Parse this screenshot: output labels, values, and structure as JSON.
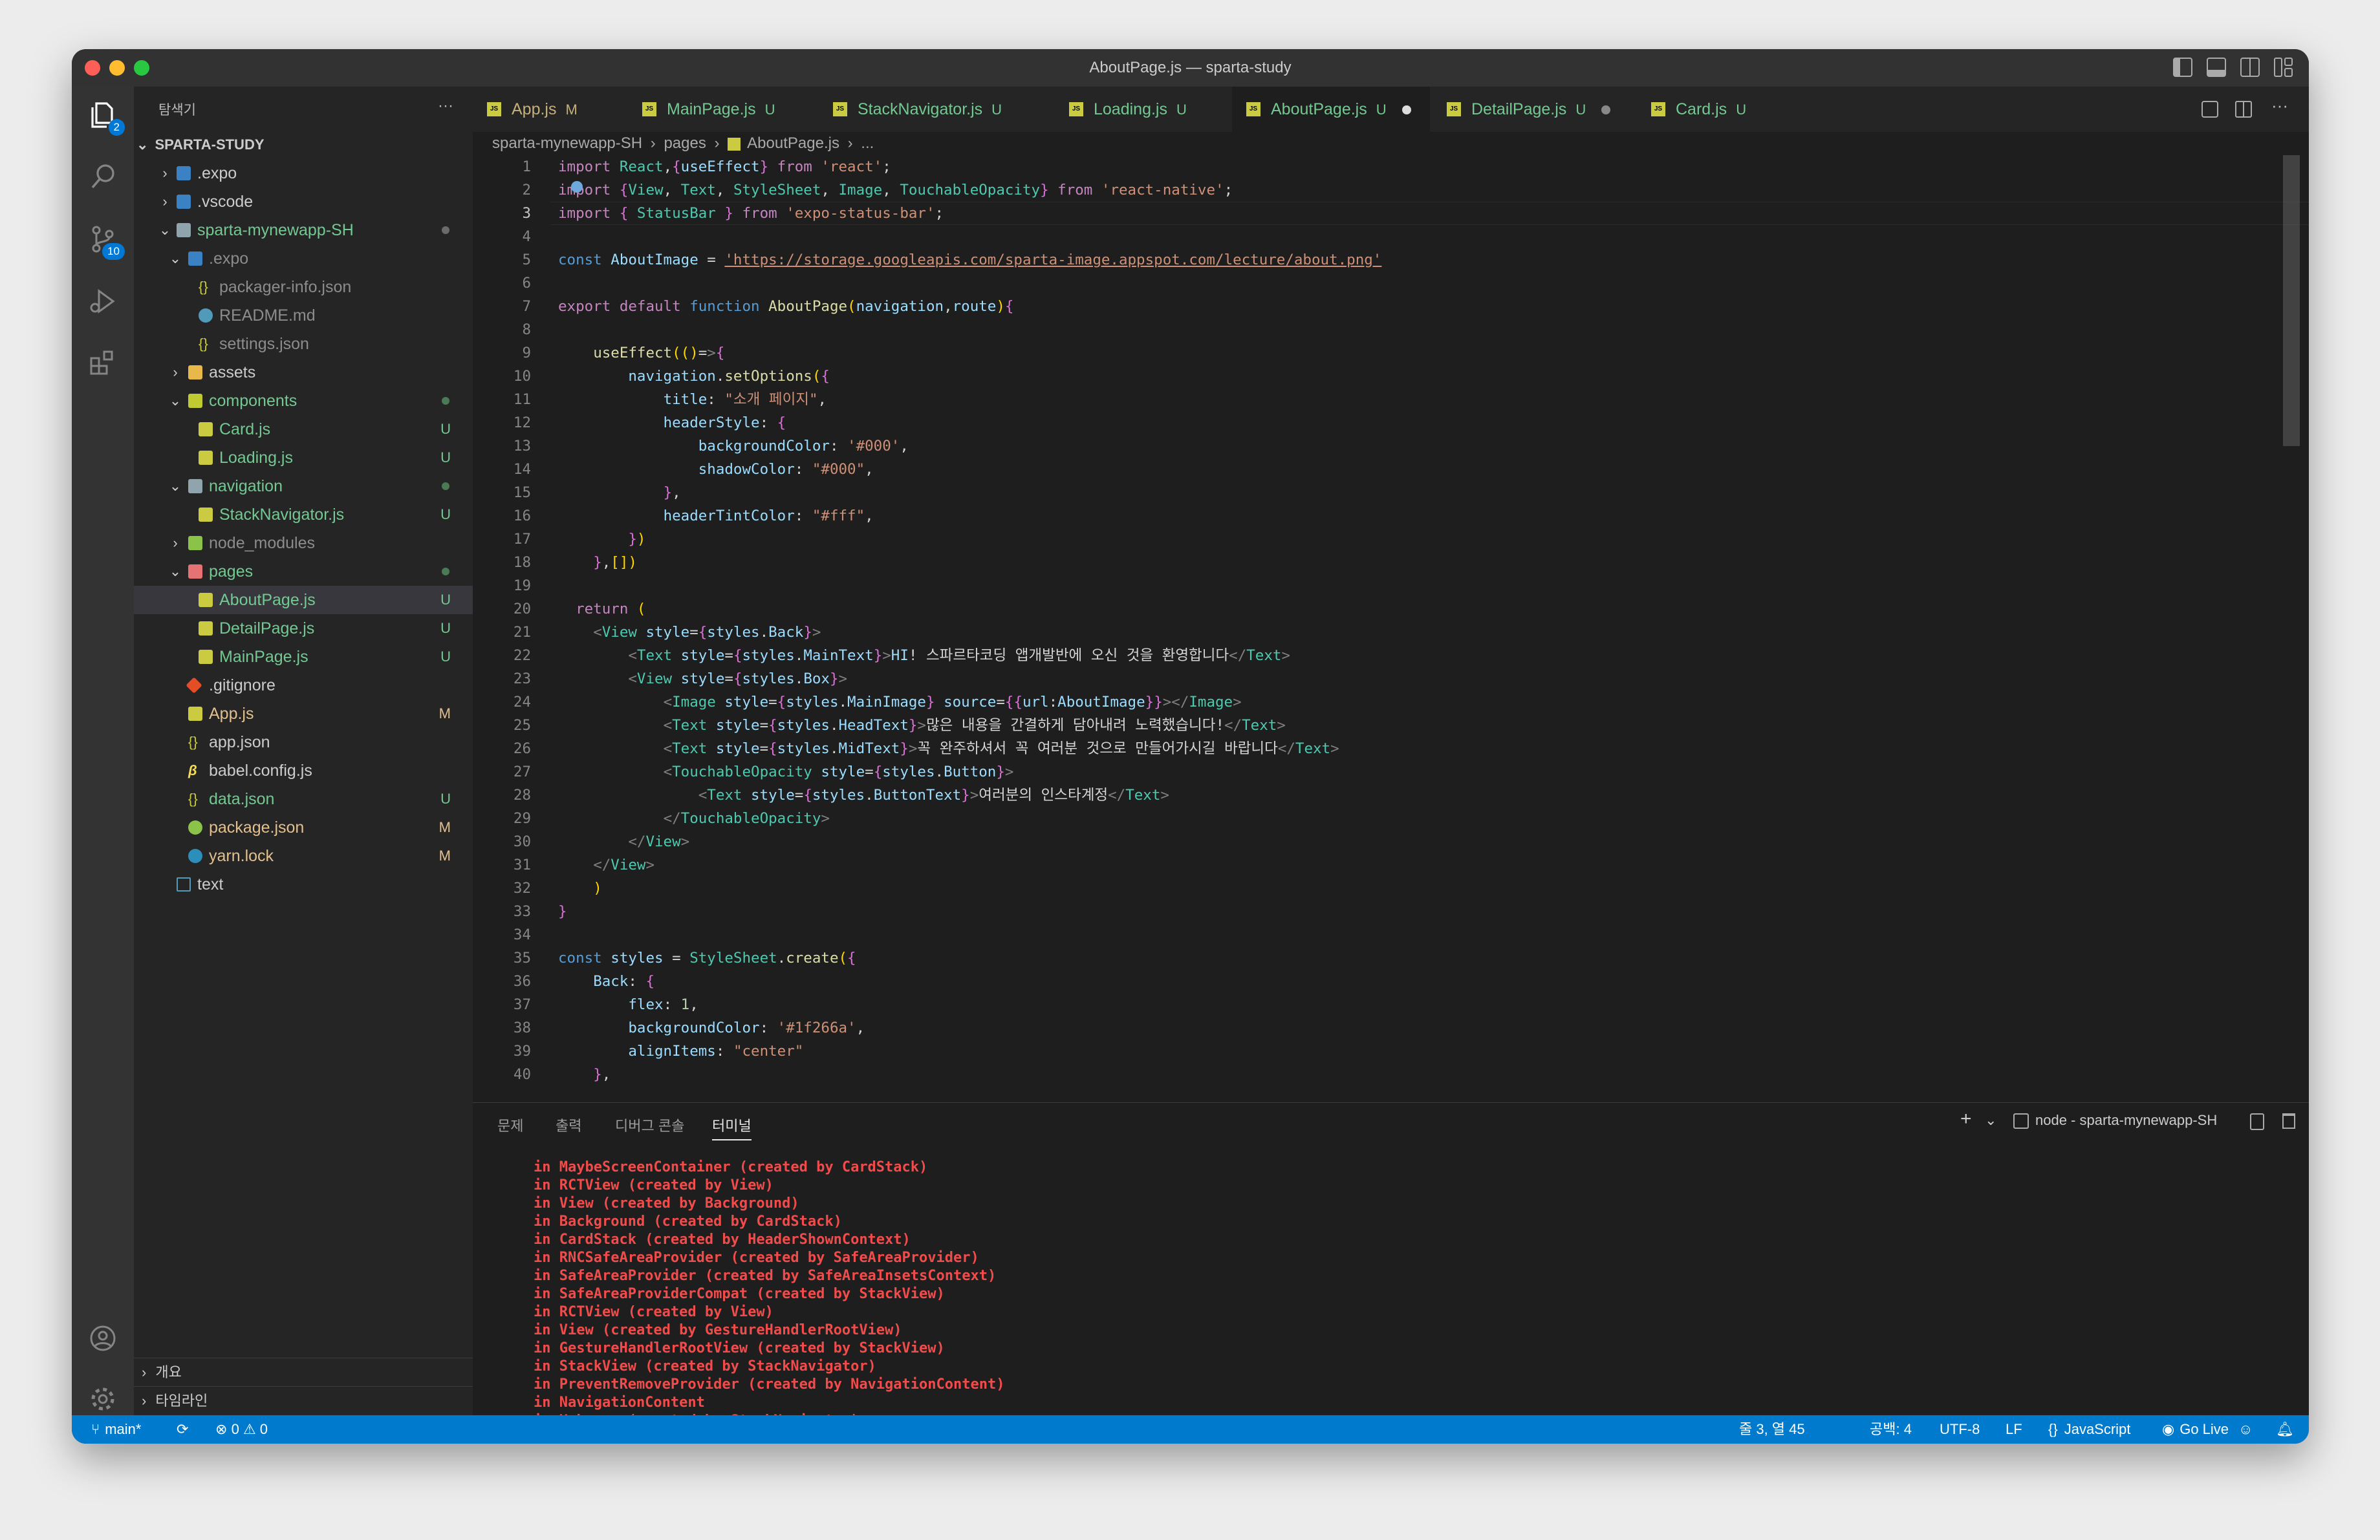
{
  "window": {
    "title": "AboutPage.js — sparta-study"
  },
  "activity_bar": {
    "explorer_badge": "2",
    "scm_badge": "10"
  },
  "sidebar": {
    "header": "탐색기",
    "more": "···",
    "project": "SPARTA-STUDY",
    "tree": [
      {
        "label": "expo",
        "prefix": ".",
        "status": "",
        "indent": 0
      },
      {
        "label": ".expo",
        "status": "",
        "kind": "folder"
      },
      {
        "label": ".vscode",
        "status": "",
        "kind": "folder"
      },
      {
        "label": "sparta-mynewapp-SH",
        "status": "dot",
        "kind": "folder-open"
      },
      {
        "label": ".expo",
        "status": "",
        "kind": "folder-open"
      },
      {
        "label": "packager-info.json",
        "status": ""
      },
      {
        "label": "README.md",
        "status": ""
      },
      {
        "label": "settings.json",
        "status": ""
      },
      {
        "label": "assets",
        "status": "",
        "kind": "folder"
      },
      {
        "label": "components",
        "status": "dot",
        "kind": "folder-open"
      },
      {
        "label": "Card.js",
        "status": "U"
      },
      {
        "label": "Loading.js",
        "status": "U"
      },
      {
        "label": "navigation",
        "status": "dot",
        "kind": "folder-open"
      },
      {
        "label": "StackNavigator.js",
        "status": "U"
      },
      {
        "label": "node_modules",
        "status": "",
        "kind": "folder"
      },
      {
        "label": "pages",
        "status": "dot",
        "kind": "folder-open"
      },
      {
        "label": "AboutPage.js",
        "status": "U"
      },
      {
        "label": "DetailPage.js",
        "status": "U"
      },
      {
        "label": "MainPage.js",
        "status": "U"
      },
      {
        "label": ".gitignore",
        "status": ""
      },
      {
        "label": "App.js",
        "status": "M"
      },
      {
        "label": "app.json",
        "status": ""
      },
      {
        "label": "babel.config.js",
        "status": ""
      },
      {
        "label": "data.json",
        "status": "U"
      },
      {
        "label": "package.json",
        "status": "M"
      },
      {
        "label": "yarn.lock",
        "status": "M"
      },
      {
        "label": "text",
        "status": ""
      }
    ],
    "outline": "개요",
    "timeline": "타임라인"
  },
  "tabs": [
    {
      "label": "App.js",
      "status": "M"
    },
    {
      "label": "MainPage.js",
      "status": "U"
    },
    {
      "label": "StackNavigator.js",
      "status": "U"
    },
    {
      "label": "Loading.js",
      "status": "U"
    },
    {
      "label": "AboutPage.js",
      "status": "U"
    },
    {
      "label": "DetailPage.js",
      "status": "U"
    },
    {
      "label": "Card.js",
      "status": "U"
    }
  ],
  "breadcrumb": [
    "sparta-mynewapp-SH",
    "pages",
    "AboutPage.js",
    "..."
  ],
  "code": {
    "l1": [
      "import React,{useEffect} from 'react';"
    ],
    "line_numbers": [
      "1",
      "2",
      "3",
      "4",
      "5",
      "6",
      "7",
      "8",
      "9",
      "10",
      "11",
      "12",
      "13",
      "14",
      "15",
      "16",
      "17",
      "18",
      "19",
      "20",
      "21",
      "22",
      "23",
      "24",
      "25",
      "26",
      "27",
      "28",
      "29",
      "30",
      "31",
      "32",
      "33",
      "34",
      "35",
      "36",
      "37",
      "38",
      "39",
      "40"
    ],
    "lines": [
      "import React,{useEffect} from 'react';",
      "import {View, Text, StyleSheet, Image, TouchableOpacity} from 'react-native';",
      "import { StatusBar } from 'expo-status-bar';",
      "",
      "const AboutImage = 'https://storage.googleapis.com/sparta-image.appspot.com/lecture/about.png'",
      "",
      "export default function AboutPage(navigation,route){",
      "",
      "    useEffect(()=>{",
      "        navigation.setOptions({",
      "            title: \"소개 페이지\",",
      "            headerStyle: {",
      "                backgroundColor: '#000',",
      "                shadowColor: \"#000\",",
      "            },",
      "            headerTintColor: \"#fff\",",
      "        })",
      "    },[])",
      "",
      "  return (",
      "    <View style={styles.Back}>",
      "        <Text style={styles.MainText}>HI! 스파르타코딩 앱개발반에 오신 것을 환영합니다</Text>",
      "        <View style={styles.Box}>",
      "            <Image style={styles.MainImage} source={{url:AboutImage}}></Image>",
      "            <Text style={styles.HeadText}>많은 내용을 간결하게 담아내려 노력했습니다!</Text>",
      "            <Text style={styles.MidText}>꼭 완주하셔서 꼭 여러분 것으로 만들어가시길 바랍니다</Text>",
      "            <TouchableOpacity style={styles.Button}>",
      "                <Text style={styles.ButtonText}>여러분의 인스타계정</Text>",
      "            </TouchableOpacity>",
      "        </View>",
      "    </View>",
      "    )",
      "}",
      "",
      "const styles = StyleSheet.create({",
      "    Back: {",
      "        flex: 1,",
      "        backgroundColor: '#1f266a',",
      "        alignItems: \"center\"",
      "    },"
    ]
  },
  "panel": {
    "tabs": [
      "문제",
      "출력",
      "디버그 콘솔",
      "터미널"
    ],
    "terminal_name": "node - sparta-mynewapp-SH",
    "lines": [
      "in MaybeScreenContainer (created by CardStack)",
      "in RCTView (created by View)",
      "in View (created by Background)",
      "in Background (created by CardStack)",
      "in CardStack (created by HeaderShownContext)",
      "in RNCSafeAreaProvider (created by SafeAreaProvider)",
      "in SafeAreaProvider (created by SafeAreaInsetsContext)",
      "in SafeAreaProviderCompat (created by StackView)",
      "in RCTView (created by View)",
      "in View (created by GestureHandlerRootView)",
      "in GestureHandlerRootView (created by StackView)",
      "in StackView (created by StackNavigator)",
      "in PreventRemoveProvider (created by NavigationContent)",
      "in NavigationContent",
      "in Unknown (created by StackNavigator)"
    ]
  },
  "status": {
    "branch": "main*",
    "errors": "0",
    "warnings": "0",
    "position": "줄 3, 열 45",
    "spaces": "공백: 4",
    "encoding": "UTF-8",
    "eol": "LF",
    "language": "JavaScript",
    "golive": "Go Live"
  },
  "colors": {
    "accent": "#007acc",
    "modified": "#e2c08d",
    "untracked": "#73c991",
    "error": "#f14c4c"
  }
}
